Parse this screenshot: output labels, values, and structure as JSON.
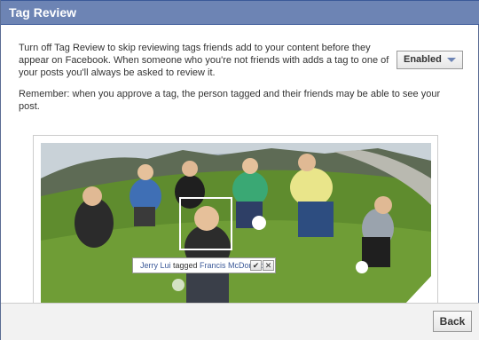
{
  "dialog": {
    "title": "Tag Review"
  },
  "content": {
    "paragraph_1": "Turn off Tag Review to skip reviewing tags friends add to your content before they appear on Facebook. When someone who you're not friends with adds a tag to one of your posts you'll always be asked to review it.",
    "paragraph_2": "Remember: when you approve a tag, the person tagged and their friends may be able to see your post.",
    "setting_dropdown": {
      "selected": "Enabled",
      "icon": "chevron-down-icon"
    }
  },
  "photo": {
    "tag_pill": {
      "tagger": "Jerry Lui",
      "verb": " tagged ",
      "tagged": "Francis McDonald",
      "suffix": ".",
      "approve_glyph": "✔",
      "reject_glyph": "✕"
    }
  },
  "footer": {
    "back_label": "Back"
  },
  "colors": {
    "header_bg": "#6d84b4",
    "header_border": "#3b5998",
    "link": "#3b5998"
  }
}
